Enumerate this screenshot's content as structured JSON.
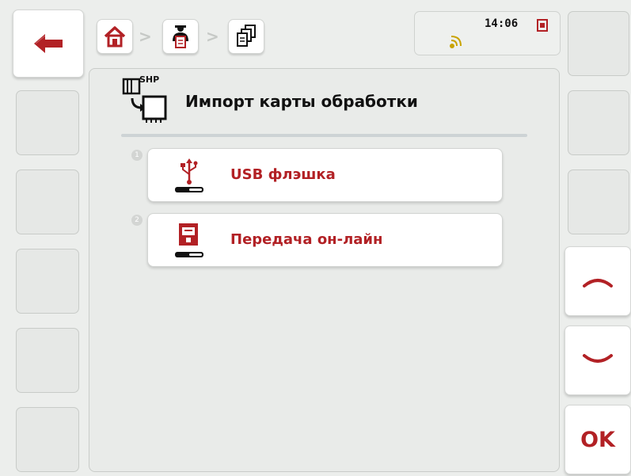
{
  "header": {
    "time": "14:06",
    "breadcrumb": [
      "home-icon",
      "operator-icon",
      "documents-icon"
    ]
  },
  "page": {
    "title": "Импорт карты обработки",
    "header_icon_label": "SHP"
  },
  "items": [
    {
      "number": "1",
      "label": "USB флэшка",
      "icon": "usb-stick-icon"
    },
    {
      "number": "2",
      "label": "Передача он-лайн",
      "icon": "online-transfer-icon"
    }
  ],
  "softkeys": {
    "ok_label": "OK"
  },
  "colors": {
    "accent": "#b22125",
    "background": "#eceeec"
  }
}
